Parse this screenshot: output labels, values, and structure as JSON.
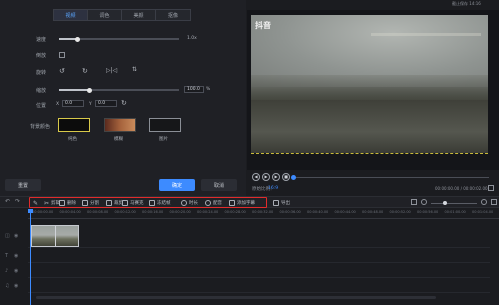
{
  "title_bar": {
    "text": "截止保存 14:16"
  },
  "tabs": [
    "视频",
    "调色",
    "美颜",
    "抠像"
  ],
  "params": {
    "speed": {
      "label": "速度",
      "value": "1.0x"
    },
    "reverse": {
      "label": "倒放"
    },
    "rotate": {
      "label": "旋转"
    },
    "scale": {
      "label": "缩放",
      "value": "100.0",
      "unit": "%"
    },
    "position": {
      "label": "位置",
      "x_label": "X",
      "x_value": "0.0",
      "y_label": "Y",
      "y_value": "0.0"
    },
    "bg": {
      "label": "背景颜色",
      "options": [
        "纯色",
        "模糊",
        "图片"
      ]
    }
  },
  "buttons": {
    "reset": "重置",
    "confirm": "确定",
    "cancel": "取消"
  },
  "preview": {
    "watermark": "抖音",
    "ratio_label": "原始比例：",
    "ratio_value": "16:9",
    "time": "00:00:00.00 / 00:00:02.00"
  },
  "toolbar": {
    "tools": [
      "剪辑",
      "删除",
      "分割",
      "裁剪",
      "马赛克",
      "冻结帧",
      "时长",
      "配音",
      "添加字幕"
    ],
    "export": "导出"
  },
  "ruler": [
    "00:00:00.00",
    "00:00:04.00",
    "00:00:08.00",
    "00:00:12.00",
    "00:00:16.00",
    "00:00:20.00",
    "00:00:24.00",
    "00:00:28.00",
    "00:00:32.00",
    "00:00:36.00",
    "00:00:40.00",
    "00:00:44.00",
    "00:00:48.00",
    "00:00:52.00",
    "00:00:56.00",
    "00:01:00.00",
    "00:01:04.00"
  ],
  "colors": {
    "accent": "#3d8bff",
    "highlight_red": "#e12b2b",
    "swatch_yellow": "#d8c94a"
  }
}
